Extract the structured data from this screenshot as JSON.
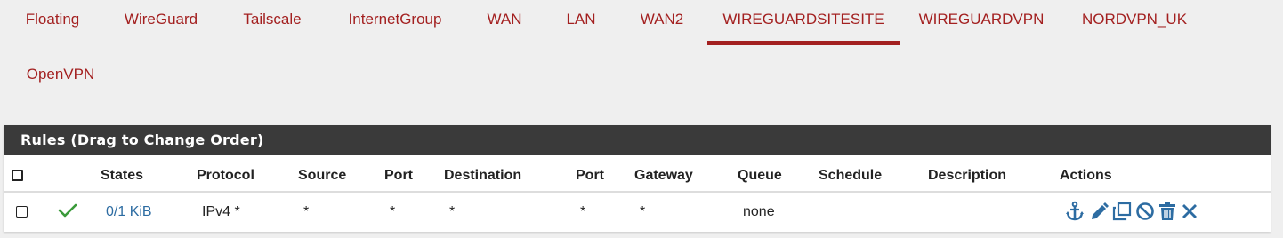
{
  "tabs": [
    {
      "label": "Floating",
      "active": false
    },
    {
      "label": "WireGuard",
      "active": false
    },
    {
      "label": "Tailscale",
      "active": false
    },
    {
      "label": "InternetGroup",
      "active": false
    },
    {
      "label": "WAN",
      "active": false
    },
    {
      "label": "LAN",
      "active": false
    },
    {
      "label": "WAN2",
      "active": false
    },
    {
      "label": "WIREGUARDSITESITE",
      "active": true
    },
    {
      "label": "WIREGUARDVPN",
      "active": false
    },
    {
      "label": "NORDVPN_UK",
      "active": false
    },
    {
      "label": "OpenVPN",
      "active": false
    }
  ],
  "panel": {
    "title": "Rules (Drag to Change Order)",
    "columns": {
      "states": "States",
      "protocol": "Protocol",
      "source": "Source",
      "source_port": "Port",
      "destination": "Destination",
      "destination_port": "Port",
      "gateway": "Gateway",
      "queue": "Queue",
      "schedule": "Schedule",
      "description": "Description",
      "actions": "Actions"
    },
    "rows": [
      {
        "enabled_icon": "check-icon",
        "states": "0/1 KiB",
        "protocol": "IPv4 *",
        "source": "*",
        "source_port": "*",
        "destination": "*",
        "destination_port": "*",
        "gateway": "*",
        "queue": "none",
        "schedule": "",
        "description": "",
        "actions": [
          "anchor-icon",
          "pencil-icon",
          "copy-icon",
          "ban-icon",
          "trash-icon",
          "times-icon"
        ]
      }
    ]
  },
  "colors": {
    "tab_text": "#a32020",
    "active_underline": "#a32020",
    "panel_heading_bg": "#3a3a3a",
    "link": "#2d6ca2",
    "action_icon": "#2d6ca2",
    "check": "#3a9a3a"
  }
}
